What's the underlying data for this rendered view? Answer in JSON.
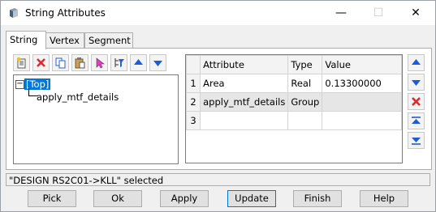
{
  "window": {
    "title": "String Attributes"
  },
  "title_buttons": {
    "minimize": "—",
    "maximize": "☐",
    "close": "✕"
  },
  "tabs": [
    {
      "label": "String",
      "active": true
    },
    {
      "label": "Vertex",
      "active": false
    },
    {
      "label": "Segment",
      "active": false
    }
  ],
  "toolbar_icons": [
    "new-attribute-icon",
    "delete-icon",
    "copy-icon",
    "paste-icon",
    "select-icon",
    "filter-tree-icon",
    "move-up-icon",
    "move-down-icon"
  ],
  "tree": {
    "root": "[Top]",
    "children": [
      "apply_mtf_details"
    ],
    "expander": "−"
  },
  "table": {
    "headers": [
      "Attribute",
      "Type",
      "Value"
    ],
    "rows": [
      {
        "num": "1",
        "attribute": "Area",
        "type": "Real",
        "value": "0.13300000"
      },
      {
        "num": "2",
        "attribute": "apply_mtf_details",
        "type": "Group",
        "value": ""
      },
      {
        "num": "3",
        "attribute": "",
        "type": "",
        "value": ""
      }
    ]
  },
  "side_buttons": [
    "move-up-icon",
    "move-down-icon",
    "delete-row-icon",
    "move-top-icon",
    "move-bottom-icon"
  ],
  "colors": {
    "selection": "#0078d7",
    "delete_red": "#d32f2f",
    "arrow_blue": "#1e5bd6"
  },
  "status": "\"DESIGN RS2C01->KLL\" selected",
  "buttons": {
    "pick": "Pick",
    "ok": "Ok",
    "apply": "Apply",
    "update": "Update",
    "finish": "Finish",
    "help": "Help"
  }
}
